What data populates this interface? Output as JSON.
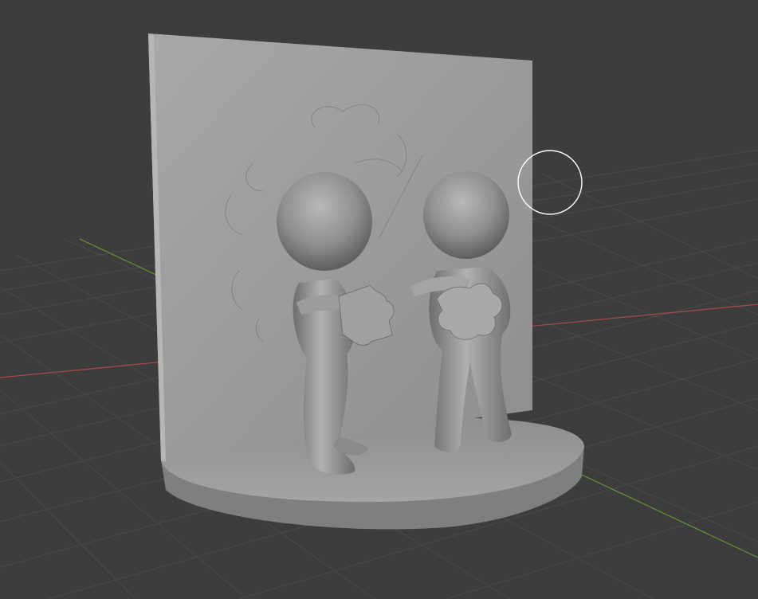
{
  "viewport": {
    "mode": "solid-shading",
    "background_color": "#3d3d3d",
    "grid_color": "#4a4a4a",
    "x_axis_color": "#a84a4a",
    "y_axis_color": "#6a8f3a",
    "model_color": "#9a9a9a",
    "brush_cursor_icon": "circle-brush-cursor-icon"
  }
}
